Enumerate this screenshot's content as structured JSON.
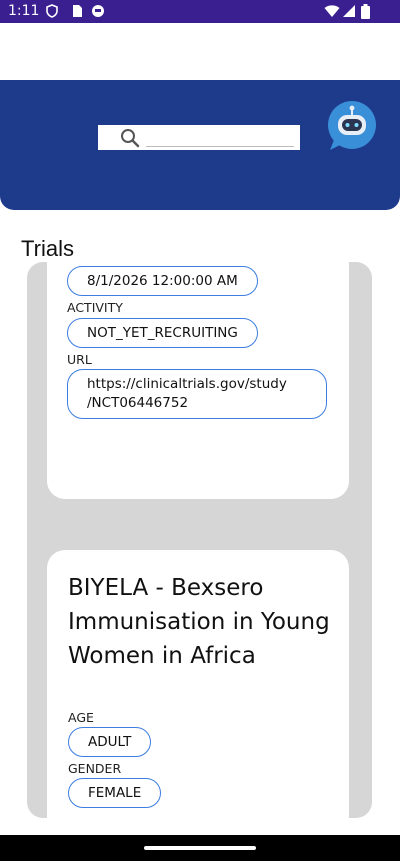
{
  "status_bar": {
    "time": "1:11",
    "icons": [
      "shield-icon",
      "sim-icon",
      "app-circle-icon",
      "wifi-icon",
      "signal-icon",
      "battery-icon"
    ]
  },
  "header": {
    "search": {
      "value": "",
      "placeholder": ""
    },
    "assistant_icon": "chat-bot-icon",
    "color": "#1e3a8a"
  },
  "page": {
    "title": "Trials"
  },
  "trials": [
    {
      "date": "8/1/2026 12:00:00 AM",
      "activity_label": "ACTIVITY",
      "activity": "NOT_YET_RECRUITING",
      "url_label": "URL",
      "url_line1": "https://clinicaltrials.gov/study",
      "url_line2": "/NCT06446752"
    },
    {
      "title": "BIYELA - Bexsero Immunisation in Young Women in Africa",
      "age_label": "AGE",
      "age": "ADULT",
      "gender_label": "GENDER",
      "gender": "FEMALE"
    }
  ],
  "colors": {
    "status_bar": "#3a1f91",
    "accent_border": "#3b7de0",
    "list_bg": "#d6d6d6"
  }
}
